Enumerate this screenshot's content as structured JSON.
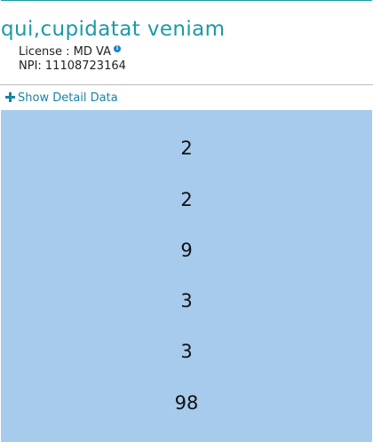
{
  "provider": {
    "name": "qui,cupidatat veniam",
    "license_label": "License : MD VA",
    "npi_label": "NPI: 11108723164"
  },
  "detail_toggle": {
    "label": "Show Detail Data",
    "icon": "plus-icon"
  },
  "data_values": [
    "2",
    "2",
    "9",
    "3",
    "3",
    "98"
  ],
  "colors": {
    "accent": "#1a9aa6",
    "link": "#1a82a6",
    "info_icon": "#1a82c9",
    "panel_background": "#a6cbec"
  }
}
